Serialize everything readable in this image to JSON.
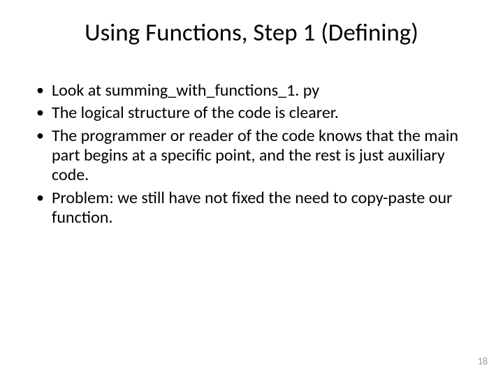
{
  "slide": {
    "title": "Using Functions, Step 1 (Defining)",
    "bullets": [
      "Look at summing_with_functions_1. py",
      "The logical structure of the code is clearer.",
      "The programmer or reader of the code knows that the main part begins at a specific point, and the rest is just auxiliary code.",
      "Problem: we still have not fixed the need to copy-paste our function."
    ],
    "page_number": "18"
  }
}
